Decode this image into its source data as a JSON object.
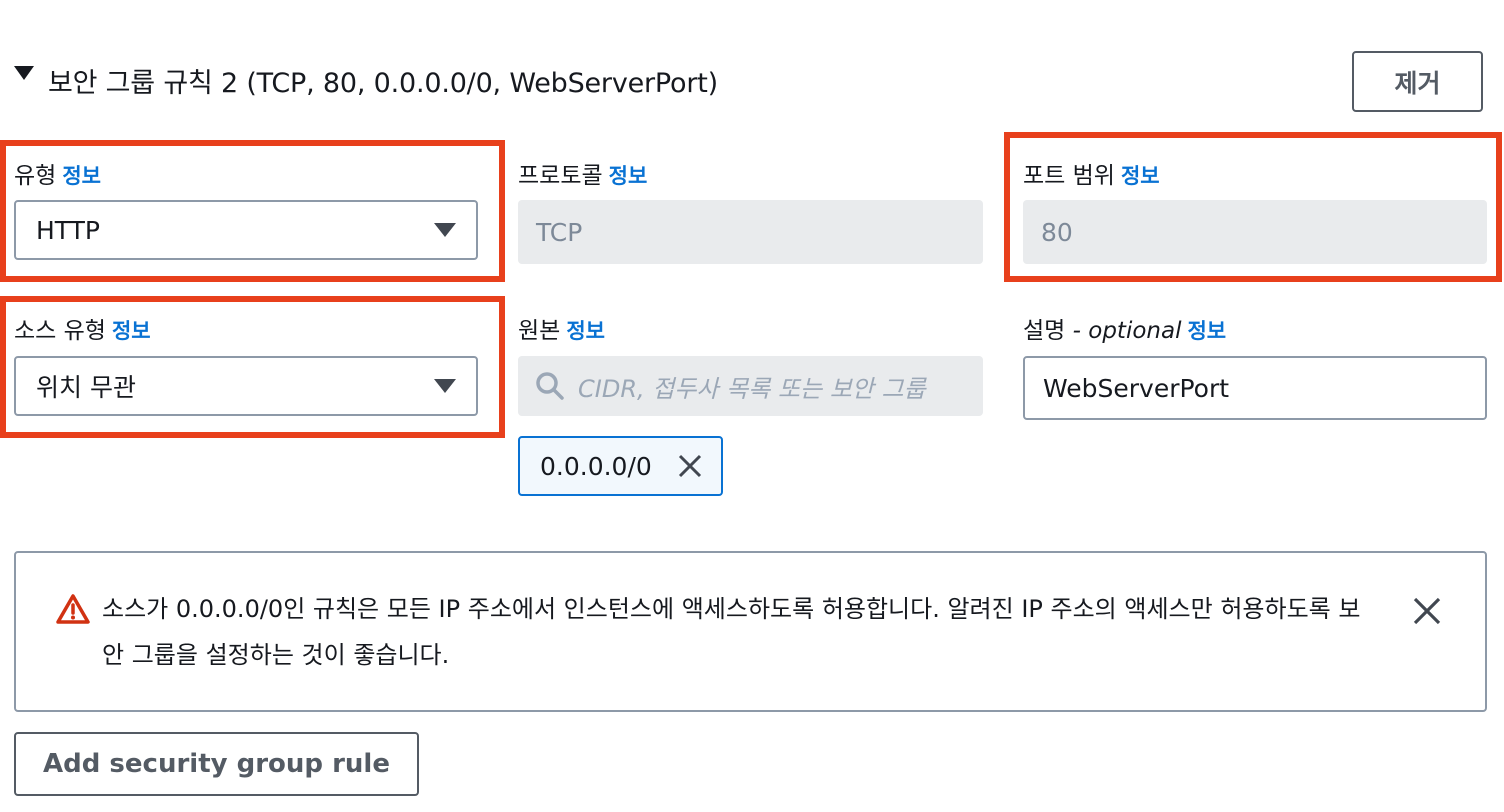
{
  "rule": {
    "title": "보안 그룹 규칙 2 (TCP, 80, 0.0.0.0/0, WebServerPort)",
    "remove_label": "제거"
  },
  "fields": {
    "type": {
      "label": "유형",
      "info": "정보",
      "value": "HTTP"
    },
    "protocol": {
      "label": "프로토콜",
      "info": "정보",
      "value": "TCP"
    },
    "port_range": {
      "label": "포트 범위",
      "info": "정보",
      "value": "80"
    },
    "source_type": {
      "label": "소스 유형",
      "info": "정보",
      "value": "위치 무관"
    },
    "source": {
      "label": "원본",
      "info": "정보",
      "placeholder": "CIDR, 접두사 목록 또는 보안 그룹",
      "token": "0.0.0.0/0"
    },
    "description": {
      "label": "설명",
      "optional": "- optional",
      "info": "정보",
      "value": "WebServerPort"
    }
  },
  "alert": {
    "message": "소스가 0.0.0.0/0인 규칙은 모든 IP 주소에서 인스턴스에 액세스하도록 허용합니다. 알려진 IP 주소의 액세스만 허용하도록 보안 그룹을 설정하는 것이 좋습니다."
  },
  "add_rule_label": "Add security group rule",
  "colors": {
    "highlight": "#e8401c",
    "link": "#0972d3",
    "warning": "#d13212",
    "disabled_bg": "#e9ebed"
  }
}
